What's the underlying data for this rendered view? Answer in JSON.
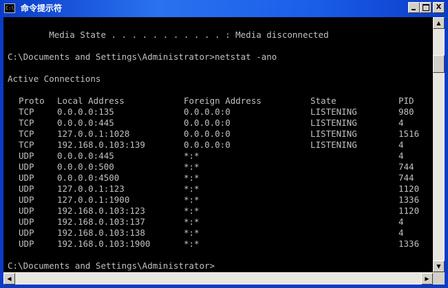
{
  "window": {
    "title": "命令提示符",
    "icon": "cmd-icon",
    "icon_text": "C:\\",
    "buttons": {
      "minimize": "minimize-icon",
      "maximize": "maximize-icon",
      "close_label": "X"
    }
  },
  "console": {
    "media_state_line": "        Media State . . . . . . . . . . . : Media disconnected",
    "command_line": "C:\\Documents and Settings\\Administrator>netstat -ano",
    "section_title": "Active Connections",
    "headers": {
      "proto": "Proto",
      "local": "Local Address",
      "foreign": "Foreign Address",
      "state": "State",
      "pid": "PID"
    },
    "rows": [
      {
        "proto": "TCP",
        "local": "0.0.0.0:135",
        "foreign": "0.0.0.0:0",
        "state": "LISTENING",
        "pid": "980"
      },
      {
        "proto": "TCP",
        "local": "0.0.0.0:445",
        "foreign": "0.0.0.0:0",
        "state": "LISTENING",
        "pid": "4"
      },
      {
        "proto": "TCP",
        "local": "127.0.0.1:1028",
        "foreign": "0.0.0.0:0",
        "state": "LISTENING",
        "pid": "1516"
      },
      {
        "proto": "TCP",
        "local": "192.168.0.103:139",
        "foreign": "0.0.0.0:0",
        "state": "LISTENING",
        "pid": "4"
      },
      {
        "proto": "UDP",
        "local": "0.0.0.0:445",
        "foreign": "*:*",
        "state": "",
        "pid": "4"
      },
      {
        "proto": "UDP",
        "local": "0.0.0.0:500",
        "foreign": "*:*",
        "state": "",
        "pid": "744"
      },
      {
        "proto": "UDP",
        "local": "0.0.0.0:4500",
        "foreign": "*:*",
        "state": "",
        "pid": "744"
      },
      {
        "proto": "UDP",
        "local": "127.0.0.1:123",
        "foreign": "*:*",
        "state": "",
        "pid": "1120"
      },
      {
        "proto": "UDP",
        "local": "127.0.0.1:1900",
        "foreign": "*:*",
        "state": "",
        "pid": "1336"
      },
      {
        "proto": "UDP",
        "local": "192.168.0.103:123",
        "foreign": "*:*",
        "state": "",
        "pid": "1120"
      },
      {
        "proto": "UDP",
        "local": "192.168.0.103:137",
        "foreign": "*:*",
        "state": "",
        "pid": "4"
      },
      {
        "proto": "UDP",
        "local": "192.168.0.103:138",
        "foreign": "*:*",
        "state": "",
        "pid": "4"
      },
      {
        "proto": "UDP",
        "local": "192.168.0.103:1900",
        "foreign": "*:*",
        "state": "",
        "pid": "1336"
      }
    ],
    "prompt_line": "C:\\Documents and Settings\\Administrator>"
  },
  "scrollbars": {
    "up": "▲",
    "down": "▼",
    "left": "◀",
    "right": "▶"
  },
  "colors": {
    "console_bg": "#000000",
    "console_text": "#c0c0c0",
    "titlebar": "#0a3cc8"
  }
}
